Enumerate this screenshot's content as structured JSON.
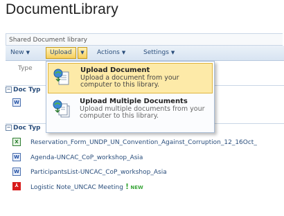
{
  "page": {
    "title": "DocumentLibrary",
    "subtitle": "Shared Document library"
  },
  "toolbar": {
    "new_label": "New",
    "upload_label": "Upload",
    "actions_label": "Actions",
    "settings_label": "Settings"
  },
  "list": {
    "type_header": "Type",
    "group1_label": "Doc Typ",
    "group2_label": "Doc Typ",
    "rows": [
      {
        "name": "Reservation_Form_UNDP_UN_Convention_Against_Corruption_12_16Oct_",
        "icon": "excel-icon"
      },
      {
        "name": "Agenda-UNCAC_CoP_workshop_Asia",
        "icon": "word-icon"
      },
      {
        "name": "ParticipantsList-UNCAC_CoP_workshop_Asia",
        "icon": "word-icon"
      },
      {
        "name": "Logistic Note_UNCAC Meeting",
        "icon": "pdf-icon"
      }
    ],
    "new_badge": "NEW",
    "new_badge_mark": "!"
  },
  "upload_menu": {
    "upload_document_title": "Upload Document",
    "upload_document_desc": "Upload a document from your computer to this library.",
    "upload_multiple_title": "Upload Multiple Documents",
    "upload_multiple_desc": "Upload multiple documents from your computer to this library."
  },
  "colors": {
    "link": "#2a4e7c",
    "highlight": "#fdeaa8",
    "toolbar_bg": "#d8e4f2"
  }
}
